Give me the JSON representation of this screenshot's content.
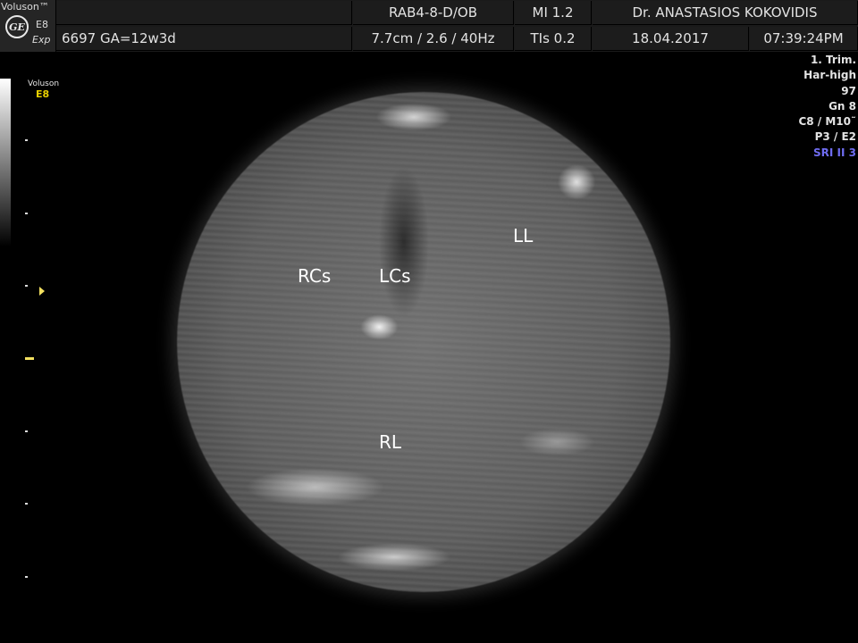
{
  "header": {
    "brand": "Voluson™",
    "logo_text": "GE",
    "model": "E8",
    "mode": "Exp",
    "patient_ga": "6697  GA=12w3d",
    "probe": "RAB4-8-D/OB",
    "mi": "MI  1.2",
    "doctor": "Dr. ANASTASIOS KOKOVIDIS",
    "depth_freq": "7.7cm / 2.6 / 40Hz",
    "tis": "TIs  0.2",
    "date": "18.04.2017",
    "time": "07:39:24PM"
  },
  "left_panel": {
    "brand": "Voluson",
    "version": "E8"
  },
  "right_params": [
    "1. Trim.",
    "Har-high",
    "97",
    "Gn   8",
    "C8 / M10˜",
    "P3 / E2",
    "SRI II 3"
  ],
  "labels": {
    "rcs": "RCs",
    "lcs": "LCs",
    "ll": "LL",
    "rl": "RL"
  },
  "colors": {
    "background": "#000000",
    "header_bg": "#1c1c1c",
    "focus_marker": "#f2e060",
    "sri_text": "#6f6cf0"
  }
}
